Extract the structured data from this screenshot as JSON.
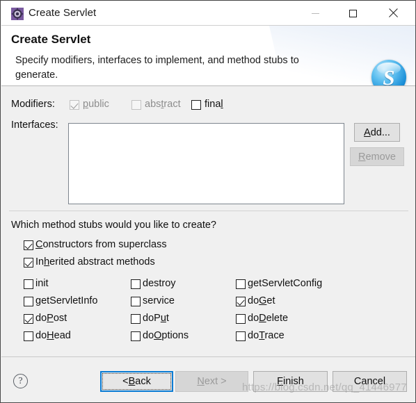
{
  "window": {
    "title": "Create Servlet",
    "icon": "servlet-wizard-icon",
    "controls": {
      "minimize": "minimize-icon",
      "maximize": "maximize-icon",
      "close": "close-icon"
    }
  },
  "banner": {
    "title": "Create Servlet",
    "description": "Specify modifiers, interfaces to implement, and method stubs to generate.",
    "icon_letter": "S",
    "icon_name": "servlet-banner-icon",
    "accent_color": "#1b8fd8"
  },
  "form": {
    "modifiers_label": "Modifiers:",
    "modifiers": [
      {
        "label": "public",
        "pre": "",
        "mnemonic": "p",
        "post": "ublic",
        "checked": true,
        "enabled": false
      },
      {
        "label": "abstract",
        "pre": "abs",
        "mnemonic": "t",
        "post": "ract",
        "checked": false,
        "enabled": false
      },
      {
        "label": "final",
        "pre": "fina",
        "mnemonic": "l",
        "post": "",
        "checked": false,
        "enabled": true
      }
    ],
    "interfaces_label": "Interfaces:",
    "interfaces_items": [],
    "add_button": {
      "pre": "",
      "mnemonic": "A",
      "post": "dd...",
      "enabled": true
    },
    "remove_button": {
      "pre": "",
      "mnemonic": "R",
      "post": "emove",
      "enabled": false
    }
  },
  "stubs": {
    "question": "Which method stubs would you like to create?",
    "top_options": [
      {
        "pre": "",
        "mnemonic": "C",
        "post": "onstructors from superclass",
        "checked": true
      },
      {
        "pre": "In",
        "mnemonic": "h",
        "post": "erited abstract methods",
        "checked": true
      }
    ],
    "grid": {
      "columns": [
        [
          {
            "pre": "init",
            "mnemonic": "",
            "post": "",
            "checked": false
          },
          {
            "pre": "getServletInfo",
            "mnemonic": "",
            "post": "",
            "checked": false
          },
          {
            "pre": "do",
            "mnemonic": "P",
            "post": "ost",
            "checked": true
          },
          {
            "pre": "do",
            "mnemonic": "H",
            "post": "ead",
            "checked": false
          }
        ],
        [
          {
            "pre": "destroy",
            "mnemonic": "",
            "post": "",
            "checked": false
          },
          {
            "pre": "service",
            "mnemonic": "",
            "post": "",
            "checked": false
          },
          {
            "pre": "doP",
            "mnemonic": "u",
            "post": "t",
            "checked": false
          },
          {
            "pre": "do",
            "mnemonic": "O",
            "post": "ptions",
            "checked": false
          }
        ],
        [
          {
            "pre": "getServletConfig",
            "mnemonic": "",
            "post": "",
            "checked": false
          },
          {
            "pre": "do",
            "mnemonic": "G",
            "post": "et",
            "checked": true
          },
          {
            "pre": "do",
            "mnemonic": "D",
            "post": "elete",
            "checked": false
          },
          {
            "pre": "do",
            "mnemonic": "T",
            "post": "race",
            "checked": false
          }
        ]
      ]
    }
  },
  "footer": {
    "help": "?",
    "buttons": [
      {
        "name": "back",
        "pre": "< ",
        "mnemonic": "B",
        "post": "ack",
        "enabled": true,
        "focused": true
      },
      {
        "name": "next",
        "pre": "",
        "mnemonic": "N",
        "post": "ext >",
        "enabled": false,
        "focused": false
      },
      {
        "name": "finish",
        "pre": "",
        "mnemonic": "F",
        "post": "inish",
        "enabled": true,
        "focused": false
      },
      {
        "name": "cancel",
        "pre": "Cancel",
        "mnemonic": "",
        "post": "",
        "enabled": true,
        "focused": false
      }
    ]
  },
  "watermark": "https://blog.csdn.net/qq_41446977"
}
